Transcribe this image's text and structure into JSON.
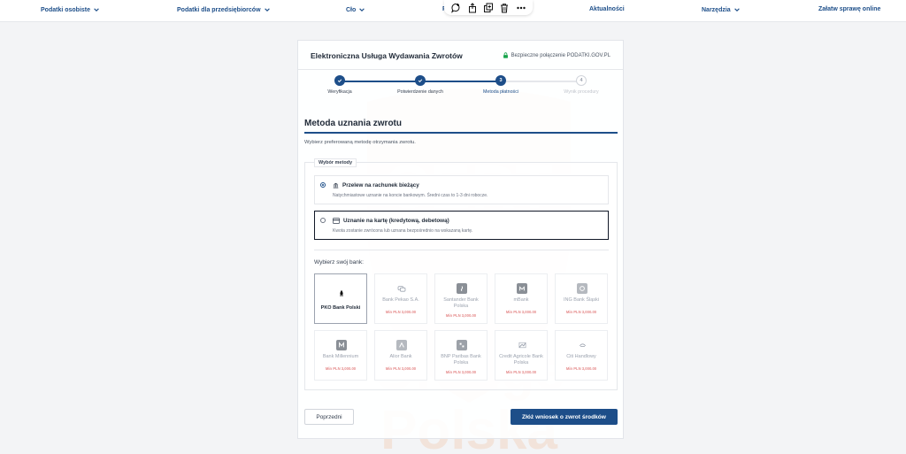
{
  "nav": {
    "items": [
      "Podatki osobiste",
      "Podatki dla przedsiębiorców",
      "Cło",
      "P",
      "Aktualności",
      "Narzędzia",
      "Załatw sprawę online"
    ]
  },
  "toolbar": {
    "icons": [
      "comment-add-icon",
      "share-icon",
      "duplicate-icon",
      "delete-icon",
      "more-icon"
    ]
  },
  "card": {
    "title": "Elektroniczna Usługa Wydawania Zwrotów",
    "secure_label": "Bezpieczne połączenie PODATKI.GOV.PL"
  },
  "stepper": {
    "steps": [
      {
        "label": "Weryfikacja",
        "state": "done"
      },
      {
        "label": "Potwierdzenie danych",
        "state": "done"
      },
      {
        "label": "Metoda płatności",
        "state": "current",
        "number": "3"
      },
      {
        "label": "Wynik procedury",
        "state": "pending",
        "number": "4"
      }
    ]
  },
  "section": {
    "title": "Metoda uznania zwrotu",
    "description": "Wybierz preferowaną metodę otrzymania zwrotu."
  },
  "methods": {
    "legend": "Wybór metody",
    "options": [
      {
        "title": "Przelew na rachunek bieżący",
        "desc": "Natychmiastowe uznanie na koncie bankowym. Średni czas to 1-3 dni robocze.",
        "selected": true
      },
      {
        "title": "Uznanie na kartę (kredytową, debetową)",
        "desc": "Kwota zostanie zwrócona lub uznana bezpośrednio na wskazaną kartę.",
        "selected": false
      }
    ]
  },
  "banks": {
    "heading": "Wybierz swój bank:",
    "items": [
      {
        "name": "PKO Bank Polski",
        "min": ""
      },
      {
        "name": "Bank Pekao S.A.",
        "min": "Min PLN 3,000.00"
      },
      {
        "name": "Santander Bank Polska",
        "min": "Min PLN 3,000.00"
      },
      {
        "name": "mBank",
        "min": "Min PLN 3,000.00"
      },
      {
        "name": "ING Bank Śląski",
        "min": "Min PLN 3,000.00"
      },
      {
        "name": "Bank Millennium",
        "min": "Min PLN 3,000.00"
      },
      {
        "name": "Alior Bank",
        "min": "Min PLN 3,000.00"
      },
      {
        "name": "BNP Paribas Bank Polska",
        "min": "Min PLN 3,000.00"
      },
      {
        "name": "Credit Agricole Bank Polska",
        "min": "Min PLN 3,000.00"
      },
      {
        "name": "Citi Handlowy",
        "min": "Min PLN 3,000.00"
      }
    ]
  },
  "actions": {
    "back_label": "Poprzedni",
    "submit_label": "Złóż wniosek o zwrot środków"
  },
  "watermark": {
    "texts": [
      "CERT",
      "Orange",
      "Polska"
    ]
  },
  "colors": {
    "primary": "#1d4e89",
    "watermark": "#f07a2a"
  }
}
